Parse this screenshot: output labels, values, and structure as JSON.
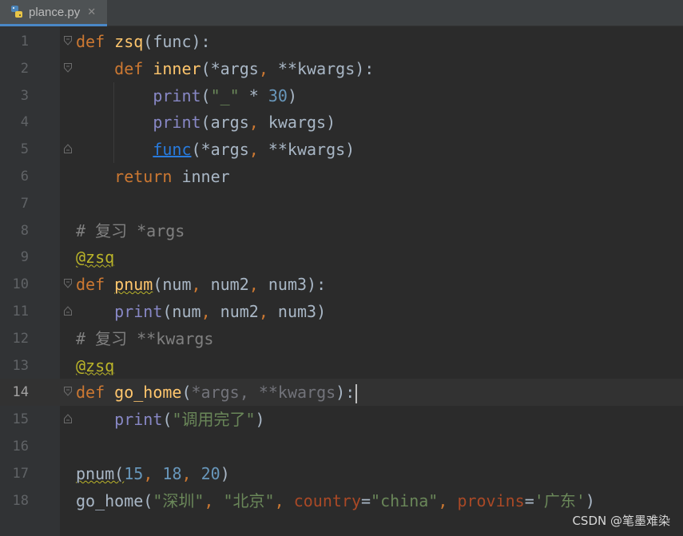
{
  "tab": {
    "filename": "plance.py",
    "close_glyph": "✕",
    "icon": "python-file-icon"
  },
  "colors": {
    "background": "#2b2b2b",
    "gutter": "#313335",
    "keyword": "#cc7832",
    "function_name": "#ffc66d",
    "builtin": "#8888c6",
    "string": "#6a8759",
    "number": "#6897bb",
    "comment": "#808080",
    "decorator": "#bbb529",
    "kwarg": "#aa4926",
    "tab_underline": "#4a88c7"
  },
  "editor": {
    "current_line": 14,
    "lines": [
      {
        "n": "1",
        "fold": "open",
        "tokens": [
          {
            "t": "def",
            "c": "kw"
          },
          {
            "t": " "
          },
          {
            "t": "zsq",
            "c": "fn"
          },
          {
            "t": "(func):"
          }
        ]
      },
      {
        "n": "2",
        "fold": "open",
        "tokens": [
          {
            "t": "    "
          },
          {
            "t": "def",
            "c": "kw"
          },
          {
            "t": " "
          },
          {
            "t": "inner",
            "c": "fn"
          },
          {
            "t": "(*args"
          },
          {
            "t": ",",
            "c": "kw"
          },
          {
            "t": " **kwargs):"
          }
        ]
      },
      {
        "n": "3",
        "tokens": [
          {
            "t": "        "
          },
          {
            "t": "print",
            "c": "bi"
          },
          {
            "t": "("
          },
          {
            "t": "\"_\"",
            "c": "str"
          },
          {
            "t": " * "
          },
          {
            "t": "30",
            "c": "num"
          },
          {
            "t": ")"
          }
        ]
      },
      {
        "n": "4",
        "tokens": [
          {
            "t": "        "
          },
          {
            "t": "print",
            "c": "bi"
          },
          {
            "t": "(args"
          },
          {
            "t": ",",
            "c": "kw"
          },
          {
            "t": " kwargs)"
          }
        ]
      },
      {
        "n": "5",
        "fold": "close",
        "tokens": [
          {
            "t": "        "
          },
          {
            "t": "func",
            "c": "ref-link"
          },
          {
            "t": "(*args"
          },
          {
            "t": ",",
            "c": "kw"
          },
          {
            "t": " **kwargs)"
          }
        ]
      },
      {
        "n": "6",
        "tokens": [
          {
            "t": "    "
          },
          {
            "t": "return",
            "c": "kw"
          },
          {
            "t": " inner"
          }
        ]
      },
      {
        "n": "7",
        "tokens": []
      },
      {
        "n": "8",
        "tokens": [
          {
            "t": "# 复习 *args",
            "c": "cm"
          }
        ]
      },
      {
        "n": "9",
        "tokens": [
          {
            "t": "@zsq",
            "c": "dec squig"
          }
        ]
      },
      {
        "n": "10",
        "fold": "open",
        "tokens": [
          {
            "t": "def",
            "c": "kw"
          },
          {
            "t": " "
          },
          {
            "t": "pnum",
            "c": "fn squig"
          },
          {
            "t": "(num"
          },
          {
            "t": ",",
            "c": "kw"
          },
          {
            "t": " num2"
          },
          {
            "t": ",",
            "c": "kw"
          },
          {
            "t": " num3):"
          }
        ]
      },
      {
        "n": "11",
        "fold": "close",
        "tokens": [
          {
            "t": "    "
          },
          {
            "t": "print",
            "c": "bi"
          },
          {
            "t": "(num"
          },
          {
            "t": ",",
            "c": "kw"
          },
          {
            "t": " num2"
          },
          {
            "t": ",",
            "c": "kw"
          },
          {
            "t": " num3)"
          }
        ]
      },
      {
        "n": "12",
        "tokens": [
          {
            "t": "# 复习 **kwargs",
            "c": "cm"
          }
        ]
      },
      {
        "n": "13",
        "tokens": [
          {
            "t": "@zsq",
            "c": "dec squig"
          }
        ]
      },
      {
        "n": "14",
        "fold": "open",
        "tokens": [
          {
            "t": "def",
            "c": "kw"
          },
          {
            "t": " "
          },
          {
            "t": "go_home",
            "c": "fn"
          },
          {
            "t": "("
          },
          {
            "t": "*args",
            "c": "param-unused"
          },
          {
            "t": ", ",
            "c": "param-unused"
          },
          {
            "t": "**kwargs",
            "c": "param-unused"
          },
          {
            "t": "):"
          }
        ],
        "caret": true
      },
      {
        "n": "15",
        "fold": "close",
        "tokens": [
          {
            "t": "    "
          },
          {
            "t": "print",
            "c": "bi"
          },
          {
            "t": "("
          },
          {
            "t": "\"调用完了\"",
            "c": "str"
          },
          {
            "t": ")"
          }
        ]
      },
      {
        "n": "16",
        "tokens": []
      },
      {
        "n": "17",
        "tokens": [
          {
            "t": "pnum(",
            "c": "squig-plain"
          },
          {
            "t": "15",
            "c": "num"
          },
          {
            "t": ",",
            "c": "kw"
          },
          {
            "t": " "
          },
          {
            "t": "18",
            "c": "num"
          },
          {
            "t": ",",
            "c": "kw"
          },
          {
            "t": " "
          },
          {
            "t": "20",
            "c": "num"
          },
          {
            "t": ")"
          }
        ]
      },
      {
        "n": "18",
        "tokens": [
          {
            "t": "go_home("
          },
          {
            "t": "\"深圳\"",
            "c": "str"
          },
          {
            "t": ",",
            "c": "kw"
          },
          {
            "t": " "
          },
          {
            "t": "\"北京\"",
            "c": "str"
          },
          {
            "t": ",",
            "c": "kw"
          },
          {
            "t": " "
          },
          {
            "t": "country",
            "c": "kwarg"
          },
          {
            "t": "="
          },
          {
            "t": "\"china\"",
            "c": "str"
          },
          {
            "t": ",",
            "c": "kw"
          },
          {
            "t": " "
          },
          {
            "t": "provins",
            "c": "kwarg"
          },
          {
            "t": "="
          },
          {
            "t": "'广东'",
            "c": "str"
          },
          {
            "t": ")"
          }
        ]
      }
    ]
  },
  "watermark": "CSDN @笔墨难染"
}
